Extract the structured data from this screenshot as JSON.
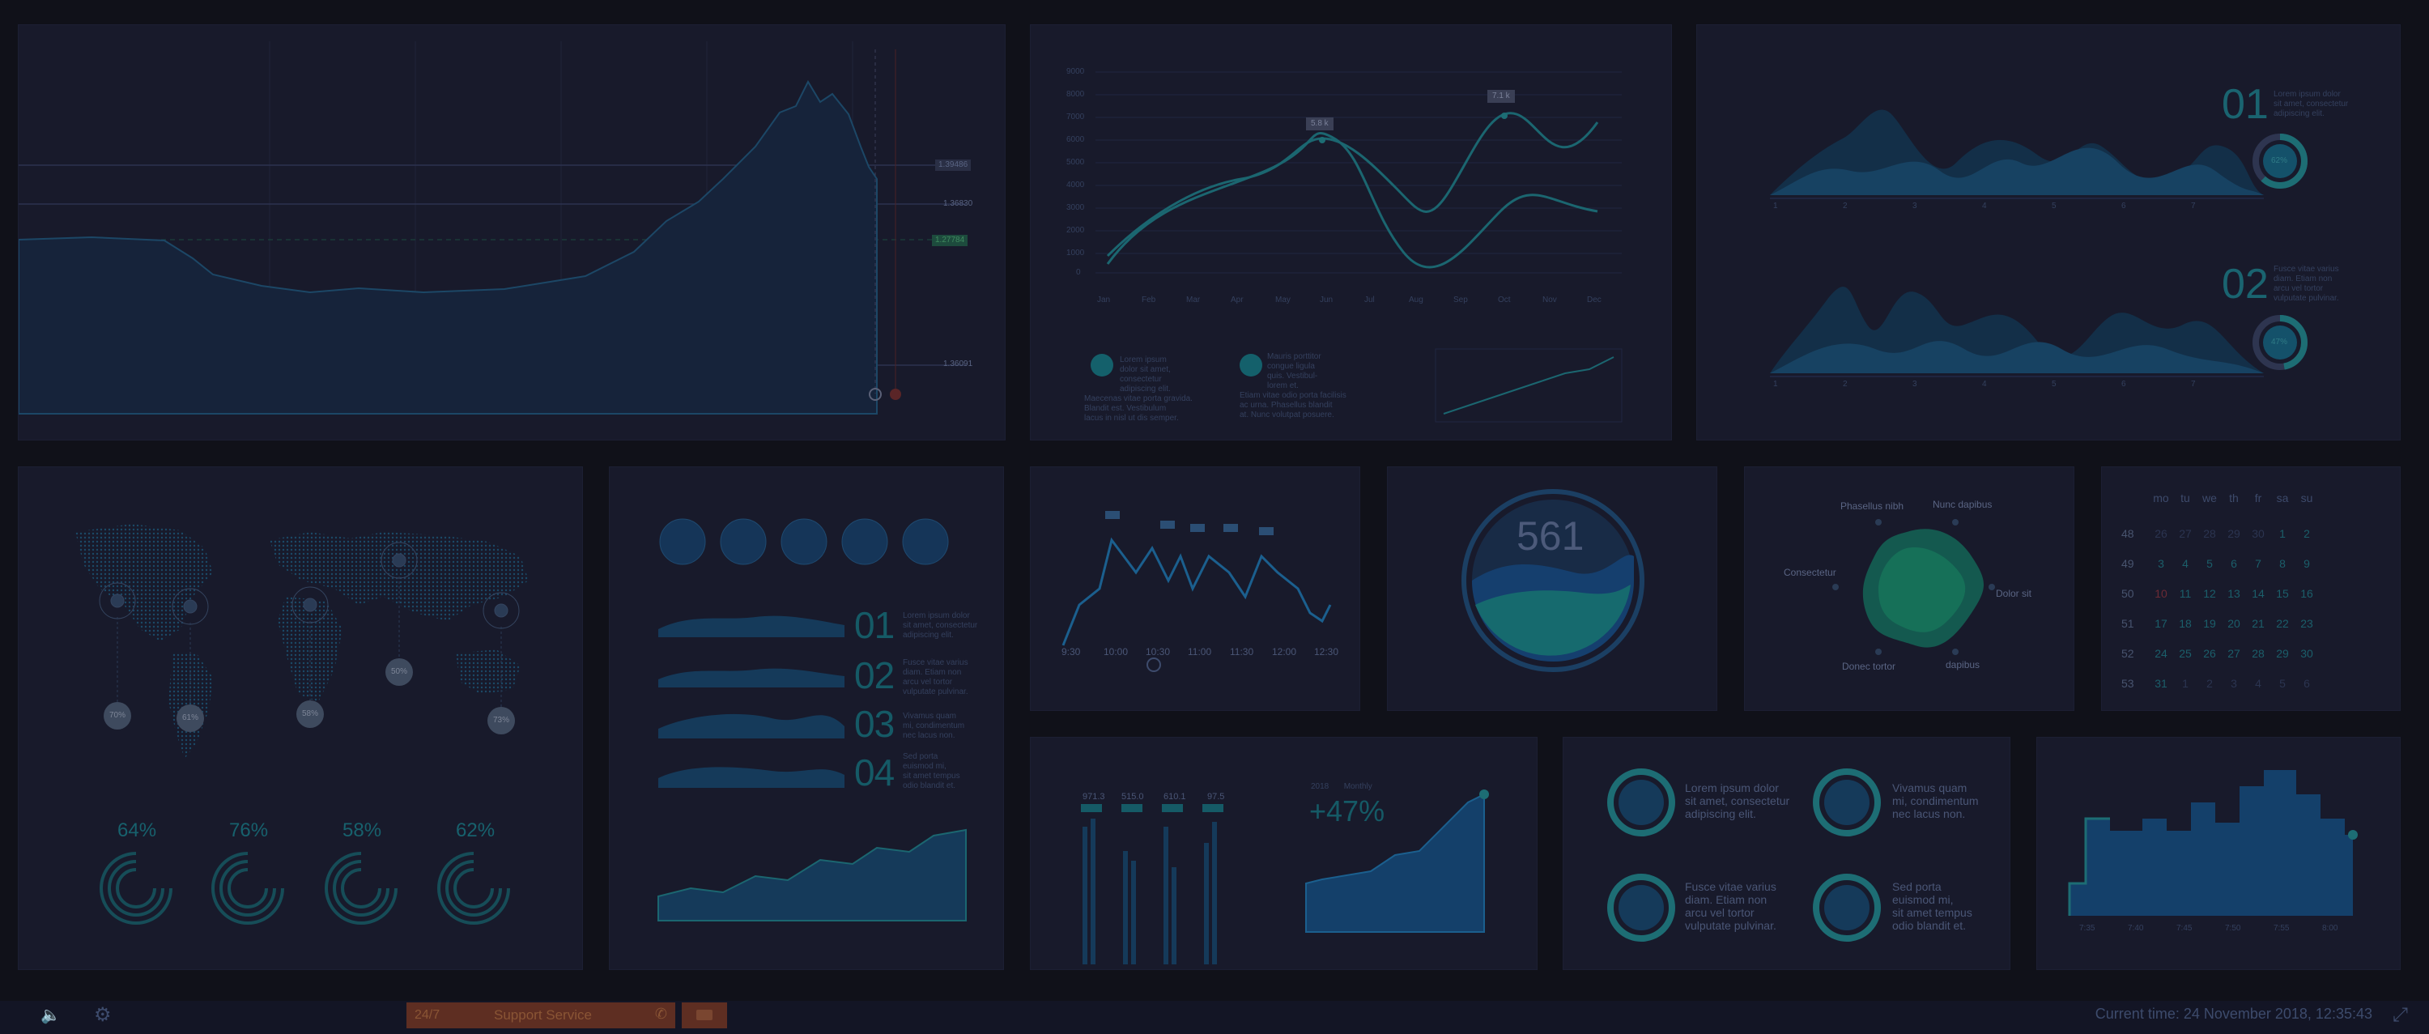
{
  "colors": {
    "background": "#101119",
    "panel": "#181a2b",
    "accent": "#1d6d74",
    "alert": "#5e2e22"
  },
  "price_chart": {
    "price_labels": [
      "1.39486",
      "1.36830",
      "1.27784",
      "1.36091"
    ]
  },
  "line_chart": {
    "y_ticks": [
      "9000",
      "8000",
      "7000",
      "6000",
      "5000",
      "4000",
      "3000",
      "2000",
      "1000",
      "0"
    ],
    "months": [
      "Jan",
      "Feb",
      "Mar",
      "Apr",
      "May",
      "Jun",
      "Jul",
      "Aug",
      "Sep",
      "Oct",
      "Nov",
      "Dec"
    ],
    "tooltip1": "5.8 k",
    "tooltip2": "7.1 k",
    "legend1": [
      "Lorem ipsum",
      "dolor sit amet,",
      "consectetur",
      "adipiscing elit."
    ],
    "legend1_more": [
      "Maecenas vitae porta gravida.",
      "Blandit est. Vestibulum",
      "lacus in nisl ut dis semper."
    ],
    "legend2": [
      "Mauris porttitor",
      "congue ligula",
      "quis. Vestibul-",
      "lorem et."
    ],
    "legend2_more": [
      "Etiam vitae odio porta facilisis",
      "ac urna. Phasellus blandit",
      "at. Nunc volutpat posuere."
    ]
  },
  "mountain": {
    "x_ticks": [
      "1",
      "2",
      "3",
      "4",
      "5",
      "6",
      "7"
    ],
    "item1": {
      "num": "01",
      "pct": "62%",
      "text": [
        "Lorem ipsum dolor",
        "sit amet, consectetur",
        "adipiscing elit."
      ]
    },
    "item2": {
      "num": "02",
      "pct": "47%",
      "text": [
        "Fusce vitae varius",
        "diam. Etiam non",
        "arcu vel tortor",
        "vulputate pulvinar."
      ]
    }
  },
  "map": {
    "pins": [
      "70%",
      "61%",
      "58%",
      "50%",
      "73%"
    ],
    "ring_pcts": [
      "64%",
      "76%",
      "58%",
      "62%"
    ]
  },
  "globe_list": {
    "items": [
      {
        "num": "01",
        "text": [
          "Lorem ipsum dolor",
          "sit amet, consectetur",
          "adipiscing elit."
        ]
      },
      {
        "num": "02",
        "text": [
          "Fusce vitae varius",
          "diam. Etiam non",
          "arcu vel tortor",
          "vulputate pulvinar."
        ]
      },
      {
        "num": "03",
        "text": [
          "Vivamus quam",
          "mi, condimentum",
          "nec lacus non."
        ]
      },
      {
        "num": "04",
        "text": [
          "Sed porta",
          "euismod mi,",
          "sit amet tempus",
          "odio blandit et."
        ]
      }
    ]
  },
  "time_chart": {
    "times": [
      "9:30",
      "10:00",
      "10:30",
      "11:00",
      "11:30",
      "12:00",
      "12:30"
    ]
  },
  "gauge": {
    "value": "561"
  },
  "radar": {
    "labels": [
      "Phasellus nibh",
      "Nunc dapibus",
      "Consectetur",
      "Dolor sit",
      "Donec tortor",
      "dapibus"
    ]
  },
  "calendar": {
    "days": [
      "mo",
      "tu",
      "we",
      "th",
      "fr",
      "sa",
      "su"
    ],
    "weeks": [
      {
        "w": "48",
        "d": [
          "26",
          "27",
          "28",
          "29",
          "30",
          "1",
          "2"
        ]
      },
      {
        "w": "49",
        "d": [
          "3",
          "4",
          "5",
          "6",
          "7",
          "8",
          "9"
        ]
      },
      {
        "w": "50",
        "d": [
          "10",
          "11",
          "12",
          "13",
          "14",
          "15",
          "16"
        ]
      },
      {
        "w": "51",
        "d": [
          "17",
          "18",
          "19",
          "20",
          "21",
          "22",
          "23"
        ]
      },
      {
        "w": "52",
        "d": [
          "24",
          "25",
          "26",
          "27",
          "28",
          "29",
          "30"
        ]
      },
      {
        "w": "53",
        "d": [
          "31",
          "1",
          "2",
          "3",
          "4",
          "5",
          "6"
        ]
      }
    ]
  },
  "bars": {
    "labels": [
      "971.3",
      "515.0",
      "610.1",
      "97.5"
    ]
  },
  "growth": {
    "legend": [
      "2018",
      "Monthly"
    ],
    "value": "+47%"
  },
  "circles": [
    [
      "Lorem ipsum dolor",
      "sit amet, consectetur",
      "adipiscing elit."
    ],
    [
      "Vivamus quam",
      "mi, condimentum",
      "nec lacus non."
    ],
    [
      "Fusce vitae varius",
      "diam. Etiam non",
      "arcu vel tortor",
      "vulputate pulvinar."
    ],
    [
      "Sed porta",
      "euismod mi,",
      "sit amet tempus",
      "odio blandit et."
    ]
  ],
  "histogram": {
    "x_ticks": [
      "7:35",
      "7:40",
      "7:45",
      "7:50",
      "7:55",
      "8:00"
    ]
  },
  "footer": {
    "support_247": "24/7",
    "support_label": "Support Service",
    "clock": "Current time: 24 November 2018, 12:35:43"
  }
}
